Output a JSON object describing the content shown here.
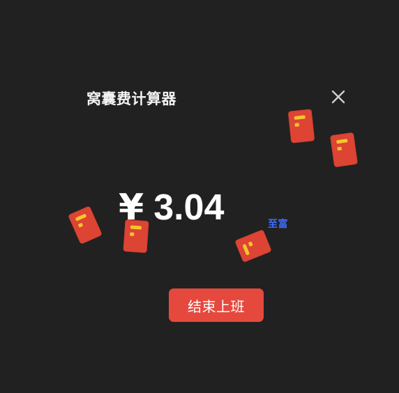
{
  "window": {
    "title": "窝囊费计算器"
  },
  "earnings": {
    "currency_symbol": "¥",
    "amount": "3.04",
    "badge": "至富"
  },
  "actions": {
    "end_work_label": "结束上班"
  },
  "decorations": {
    "icon": "red-envelope-icon",
    "count": 5
  },
  "colors": {
    "background": "#212121",
    "accent": "#e5493e",
    "badge": "#3d6fff",
    "envelope": "#dd4434",
    "envelope_trim": "#f5c52c"
  }
}
